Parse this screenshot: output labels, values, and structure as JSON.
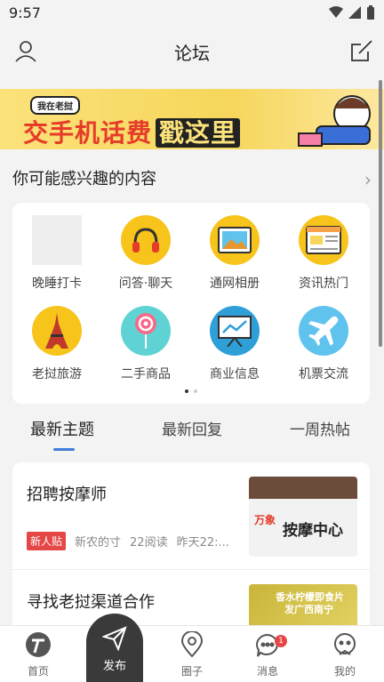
{
  "status": {
    "time": "9:57"
  },
  "header": {
    "title": "论坛"
  },
  "banner": {
    "tag": "我在老挝",
    "slogan_part1": "交手机话费",
    "slogan_part2": "戳这里"
  },
  "interest": {
    "title": "你可能感兴趣的内容",
    "items": [
      {
        "label": "晚睡打卡",
        "icon": "placeholder-icon",
        "color": "#eeeeee"
      },
      {
        "label": "问答·聊天",
        "icon": "headphones-icon",
        "color": "#f7c41b"
      },
      {
        "label": "通网相册",
        "icon": "photo-album-icon",
        "color": "#f7c41b"
      },
      {
        "label": "资讯热门",
        "icon": "news-browser-icon",
        "color": "#f7c41b"
      },
      {
        "label": "老挝旅游",
        "icon": "eiffel-tower-icon",
        "color": "#f7c41b"
      },
      {
        "label": "二手商品",
        "icon": "lollipop-icon",
        "color": "#5fd3d3"
      },
      {
        "label": "商业信息",
        "icon": "presentation-chart-icon",
        "color": "#2f9fd8"
      },
      {
        "label": "机票交流",
        "icon": "airplane-icon",
        "color": "#5fc3ee"
      }
    ]
  },
  "tabs": [
    "最新主题",
    "最新回复",
    "一周热帖"
  ],
  "posts": [
    {
      "title": "招聘按摩师",
      "badge": "新人贴",
      "author": "新农的寸",
      "reads": "22阅读",
      "time": "昨天22:...",
      "thumb_text_1": "万象",
      "thumb_text_2": "按摩中心"
    },
    {
      "title": "寻找老挝渠道合作",
      "thumb_text_1": "香水柠檬即食片",
      "thumb_text_2": "发广西南宁"
    }
  ],
  "bottom_nav": {
    "home": "首页",
    "publish": "发布",
    "circle": "圈子",
    "messages": "消息",
    "messages_badge": "1",
    "mine": "我的"
  }
}
